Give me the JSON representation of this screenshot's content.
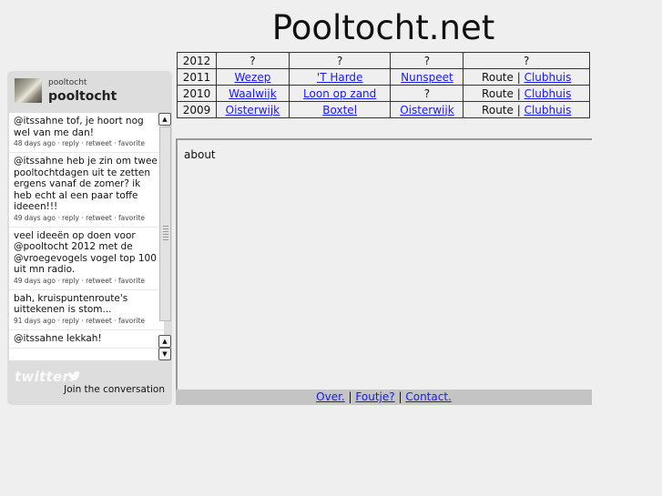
{
  "site": {
    "title": "Pooltocht.net"
  },
  "twitter": {
    "screen_name": "pooltocht",
    "display_name": "pooltocht",
    "tweets": [
      {
        "text": "@itssahne tof, je hoort nog wel van me dan!",
        "meta": "48 days ago · reply · retweet · favorite"
      },
      {
        "text": "@itssahne heb je zin om twee pooltochtdagen uit te zetten ergens vanaf de zomer? ik heb echt al een paar toffe ideeen!!!",
        "meta": "49 days ago · reply · retweet · favorite"
      },
      {
        "text": "veel ideeën op doen voor @pooltocht 2012 met de @vroegevogels vogel top 100 uit mn radio.",
        "meta": "49 days ago · reply · retweet · favorite"
      },
      {
        "text": "bah, kruispuntenroute's uittekenen is stom...",
        "meta": "91 days ago · reply · retweet · favorite"
      },
      {
        "text": "@itssahne lekkah!",
        "meta": ""
      }
    ],
    "logo_text": "twitter",
    "join_label": "Join the conversation"
  },
  "tours": {
    "rows": [
      {
        "year": "2012",
        "c1": "?",
        "c2": "?",
        "c3": "?",
        "c4": "?"
      },
      {
        "year": "2011",
        "c1": "Wezep",
        "c2": "'T Harde",
        "c3": "Nunspeet",
        "route": "Route",
        "sep": "|",
        "clubhuis": "Clubhuis"
      },
      {
        "year": "2010",
        "c1": "Waalwijk",
        "c2": "Loon op zand",
        "c3": "?",
        "route": "Route",
        "sep": "|",
        "clubhuis": "Clubhuis"
      },
      {
        "year": "2009",
        "c1": "Oisterwijk",
        "c2": "Boxtel",
        "c3": "Oisterwijk",
        "route": "Route",
        "sep": "|",
        "clubhuis": "Clubhuis"
      }
    ]
  },
  "content": {
    "about": "about"
  },
  "footer": {
    "over": "Over.",
    "foutje": "Foutje?",
    "contact": "Contact.",
    "sep": "|"
  },
  "colors": {
    "link": "#1a1aee",
    "background": "#efefef",
    "footer": "#c4c4c4"
  }
}
